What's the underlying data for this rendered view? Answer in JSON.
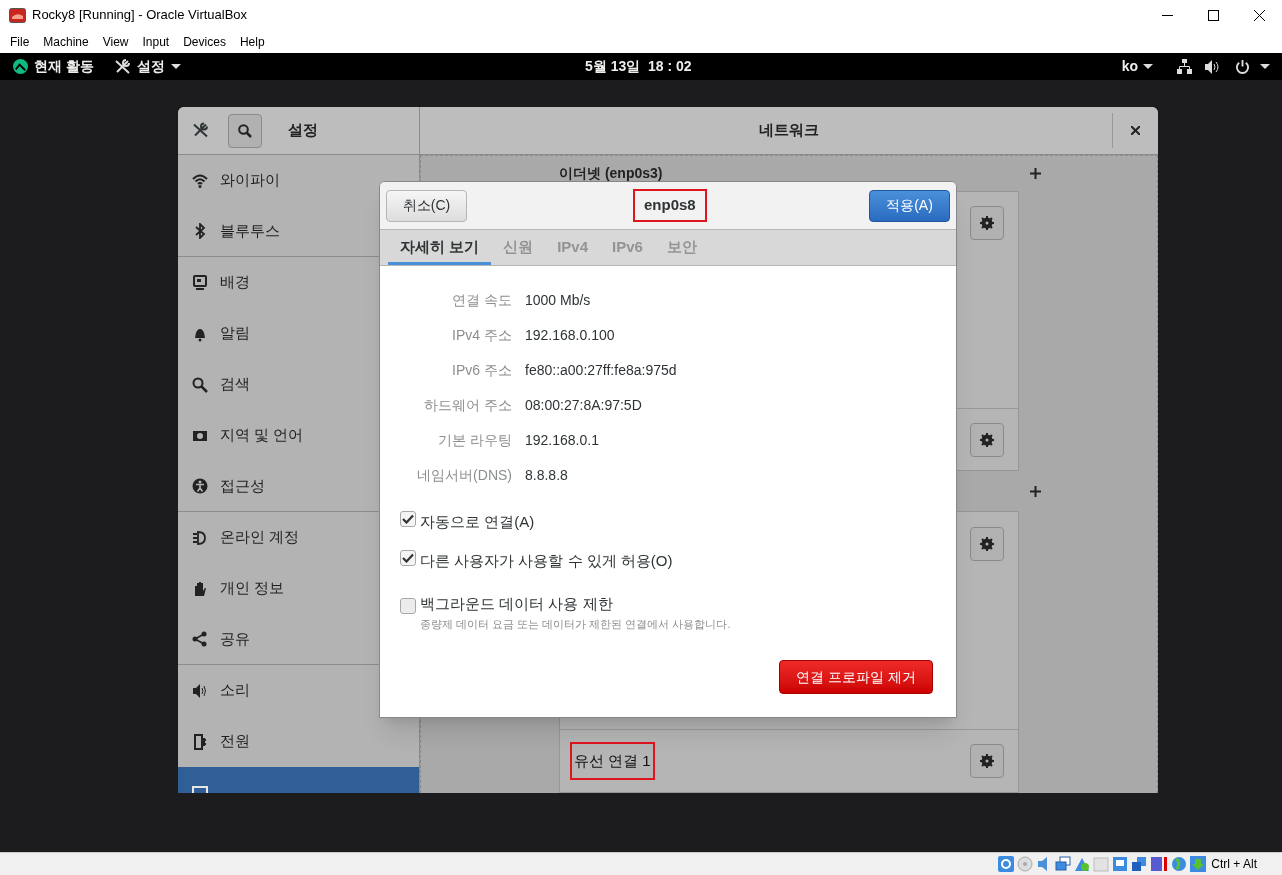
{
  "vbox": {
    "title": "Rocky8 [Running] - Oracle VirtualBox",
    "menu": [
      "File",
      "Machine",
      "View",
      "Input",
      "Devices",
      "Help"
    ],
    "host_key": "Ctrl + Alt"
  },
  "topbar": {
    "activities": "현재 활동",
    "app_menu": "설정",
    "clock": "5월 13일  18 : 02",
    "input_method": "ko"
  },
  "settings": {
    "title": "설정",
    "panel_title": "네트워크",
    "sidebar": {
      "groups": [
        {
          "items": [
            {
              "label": "와이파이",
              "selected": false
            },
            {
              "label": "블루투스",
              "selected": false
            }
          ]
        },
        {
          "items": [
            {
              "label": "배경",
              "selected": false
            },
            {
              "label": "알림",
              "selected": false
            },
            {
              "label": "검색",
              "selected": false
            },
            {
              "label": "지역 및 언어",
              "selected": false
            },
            {
              "label": "접근성",
              "selected": false
            }
          ]
        },
        {
          "items": [
            {
              "label": "온라인 계정",
              "selected": false
            },
            {
              "label": "개인 정보",
              "selected": false
            },
            {
              "label": "공유",
              "selected": false
            }
          ]
        },
        {
          "items": [
            {
              "label": "소리",
              "selected": false
            },
            {
              "label": "전원",
              "selected": false
            },
            {
              "selected": true
            }
          ]
        }
      ]
    },
    "network": {
      "ethernet_header": "이더넷 (enp0s3)",
      "connection": {
        "label": "유선 연결 1",
        "highlighted": true
      }
    }
  },
  "dialog": {
    "title": "enp0s8",
    "title_highlighted": true,
    "cancel": "취소(C)",
    "apply": "적용(A)",
    "tabs": [
      {
        "label": "자세히 보기",
        "selected": true
      },
      {
        "label": "신원",
        "selected": false
      },
      {
        "label": "IPv4",
        "selected": false
      },
      {
        "label": "IPv6",
        "selected": false
      },
      {
        "label": "보안",
        "selected": false
      }
    ],
    "details": [
      {
        "label": "연결 속도",
        "value": "1000 Mb/s"
      },
      {
        "label": "IPv4 주소",
        "value": "192.168.0.100"
      },
      {
        "label": "IPv6 주소",
        "value": "fe80::a00:27ff:fe8a:975d"
      },
      {
        "label": "하드웨어 주소",
        "value": "08:00:27:8A:97:5D"
      },
      {
        "label": "기본 라우팅",
        "value": "192.168.0.1"
      },
      {
        "label": "네임서버(DNS)",
        "value": "8.8.8.8"
      }
    ],
    "options": [
      {
        "label": "자동으로 연결(A)",
        "checked": true
      },
      {
        "label": "다른 사용자가 사용할 수 있게 허용(O)",
        "checked": true
      },
      {
        "label": "백그라운드 데이터 사용 제한",
        "checked": false,
        "description": "종량제 데이터 요금 또는 데이터가 제한된 연결에서 사용합니다."
      }
    ],
    "remove": "연결 프로파일 제거"
  }
}
